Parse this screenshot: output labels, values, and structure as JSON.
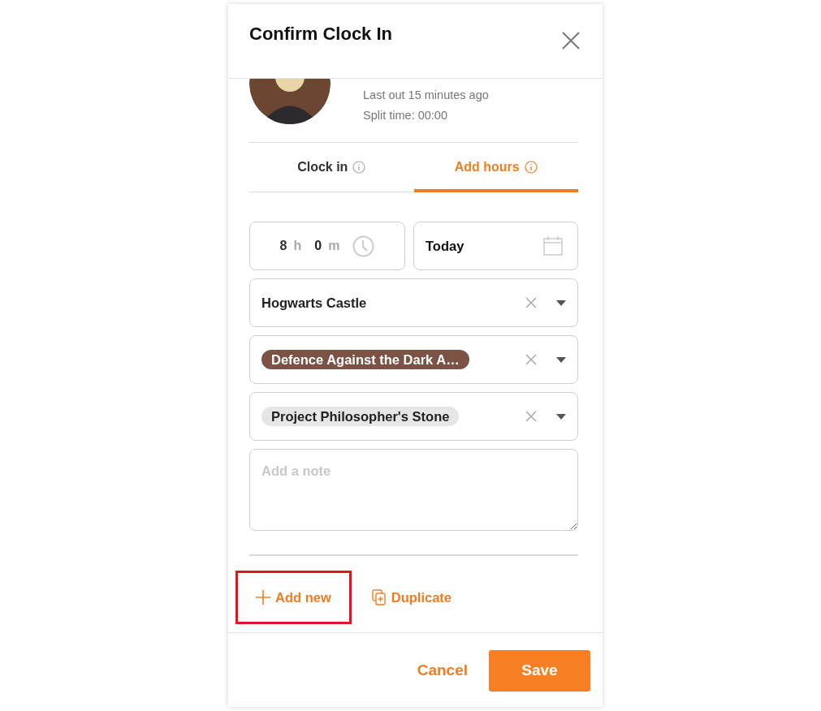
{
  "dialog": {
    "title": "Confirm Clock In"
  },
  "employee": {
    "status_lines": [
      "Last out 15 minutes ago",
      "Split time: 00:00"
    ]
  },
  "tabs": [
    {
      "label": "Clock in",
      "selected": false
    },
    {
      "label": "Add hours",
      "selected": true
    }
  ],
  "duration": {
    "hours": "8",
    "hours_unit": "h",
    "minutes": "0",
    "minutes_unit": "m"
  },
  "date": {
    "value": "Today"
  },
  "selects": [
    {
      "kind": "text",
      "value": "Hogwarts Castle"
    },
    {
      "kind": "tag",
      "value": "Defence Against the Dark A…",
      "color": "#7b5244"
    },
    {
      "kind": "tag",
      "value": "Project Philosopher's Stone",
      "color": "#e6e6e6"
    }
  ],
  "note": {
    "placeholder": "Add a note"
  },
  "actions": [
    {
      "kind": "add",
      "label": "Add new",
      "highlighted": true
    },
    {
      "kind": "duplicate",
      "label": "Duplicate",
      "highlighted": false
    }
  ],
  "footer": {
    "cancel": "Cancel",
    "save": "Save"
  }
}
